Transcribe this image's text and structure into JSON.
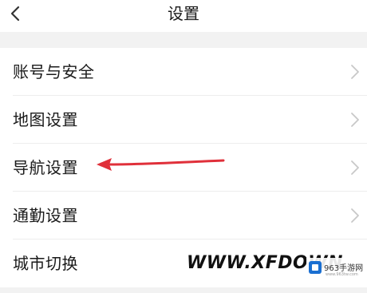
{
  "header": {
    "title": "设置",
    "back_icon": "chevron-left-icon"
  },
  "settings": {
    "items": [
      {
        "label": "账号与安全",
        "icon": "chevron-right-icon"
      },
      {
        "label": "地图设置",
        "icon": "chevron-right-icon"
      },
      {
        "label": "导航设置",
        "icon": "chevron-right-icon"
      },
      {
        "label": "通勤设置",
        "icon": "chevron-right-icon"
      },
      {
        "label": "城市切换",
        "icon": "chevron-right-icon"
      }
    ]
  },
  "annotation": {
    "arrow_color": "#e0303a",
    "target": "导航设置"
  },
  "watermark": {
    "text": "WWW.XFDOWN",
    "logo_text": "963手游网",
    "logo_sub": "www.963tw.com"
  },
  "colors": {
    "background": "#f2f2f2",
    "surface": "#ffffff",
    "text": "#1a1a1a",
    "chevron": "#c8c8c8",
    "arrow": "#e0303a"
  }
}
